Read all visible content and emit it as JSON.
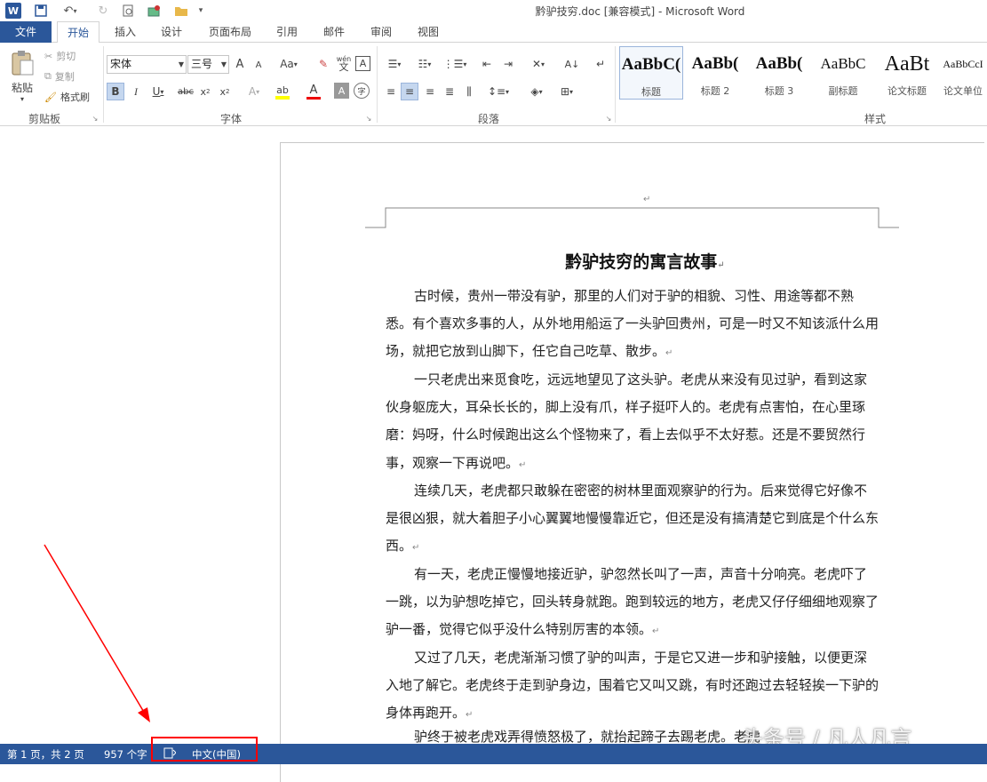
{
  "window": {
    "title": "黔驴技穷.doc [兼容模式] - Microsoft Word",
    "app_icon": "W"
  },
  "tabs": [
    {
      "label": "文件"
    },
    {
      "label": "开始"
    },
    {
      "label": "插入"
    },
    {
      "label": "设计"
    },
    {
      "label": "页面布局"
    },
    {
      "label": "引用"
    },
    {
      "label": "邮件"
    },
    {
      "label": "审阅"
    },
    {
      "label": "视图"
    }
  ],
  "clipboard": {
    "paste": "粘贴",
    "cut": "剪切",
    "copy": "复制",
    "format_painter": "格式刷",
    "label": "剪贴板"
  },
  "font": {
    "name": "宋体",
    "size": "三号",
    "label": "字体",
    "case_btn": "Aa",
    "phonetic": "wén",
    "grow": "A",
    "shrink": "A"
  },
  "paragraph": {
    "label": "段落"
  },
  "styles": {
    "label": "样式",
    "items": [
      {
        "preview": "AaBbC(",
        "name": "标题"
      },
      {
        "preview": "AaBb(",
        "name": "标题 2"
      },
      {
        "preview": "AaBb(",
        "name": "标题 3"
      },
      {
        "preview": "AaBbC",
        "name": "副标题"
      },
      {
        "preview": "AaBt",
        "name": "论文标题"
      },
      {
        "preview": "AaBbCcI",
        "name": "论文单位"
      }
    ]
  },
  "document": {
    "title": "黔驴技穷的寓言故事",
    "paragraphs": [
      "古时候，贵州一带没有驴，那里的人们对于驴的相貌、习性、用途等都不熟悉。有个喜欢多事的人，从外地用船运了一头驴回贵州，可是一时又不知该派什么用场，就把它放到山脚下，任它自己吃草、散步。",
      "一只老虎出来觅食吃，远远地望见了这头驴。老虎从来没有见过驴，看到这家伙身躯庞大，耳朵长长的，脚上没有爪，样子挺吓人的。老虎有点害怕，在心里琢磨：妈呀，什么时候跑出这么个怪物来了，看上去似乎不太好惹。还是不要贸然行事，观察一下再说吧。",
      "连续几天，老虎都只敢躲在密密的树林里面观察驴的行为。后来觉得它好像不是很凶狠，就大着胆子小心翼翼地慢慢靠近它，但还是没有搞清楚它到底是个什么东西。",
      "有一天，老虎正慢慢地接近驴，驴忽然长叫了一声，声音十分响亮。老虎吓了一跳，以为驴想吃掉它，回头转身就跑。跑到较远的地方，老虎又仔仔细细地观察了驴一番，觉得它似乎没什么特别厉害的本领。",
      "又过了几天，老虎渐渐习惯了驴的叫声，于是它又进一步和驴接触，以便更深入地了解它。老虎终于走到驴身边，围着它又叫又跳，有时还跑过去轻轻挨一下驴的身体再跑开。",
      "驴终于被老虎戏弄得愤怒极了，就抬起蹄子去踢老虎。老虎"
    ],
    "para_mark": "↵"
  },
  "status": {
    "page": "第 1 页，共 2 页",
    "words": "957 个字",
    "language": "中文(中国)"
  },
  "watermark": "头条号 / 凡人凡言",
  "colors": {
    "brand": "#2b579a",
    "annotation": "#ff0000"
  }
}
